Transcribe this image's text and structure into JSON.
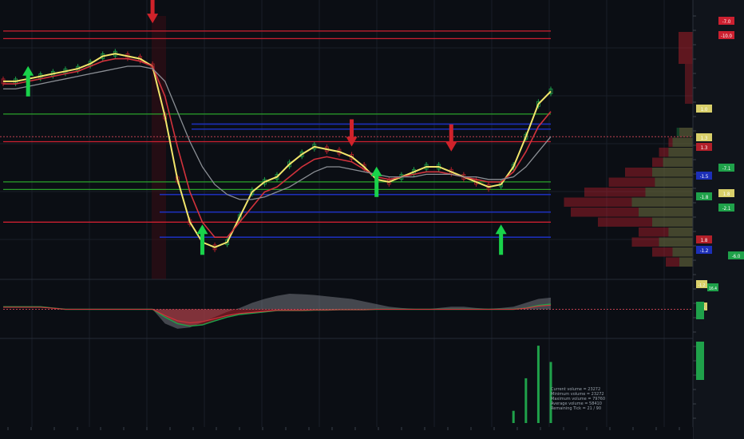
{
  "colors": {
    "background": "#0b0e14",
    "bull": "#1fa14a",
    "bear": "#b3202a",
    "fast_ma": "#f2e66b",
    "slow_ma": "#d2323c",
    "mid_ma": "#8b8f95",
    "support_line": "#2aa02a",
    "resistance_line": "#cc2030",
    "blue_level": "#1c2fb8",
    "buy_arrow": "#19d24a",
    "sell_arrow": "#d0222a"
  },
  "chart_data": [
    {
      "type": "line",
      "panel": "price",
      "series": [
        {
          "values": [
            0.74,
            0.74,
            0.75,
            0.76,
            0.77,
            0.78,
            0.79,
            0.81,
            0.84,
            0.85,
            0.84,
            0.83,
            0.8,
            0.6,
            0.35,
            0.18,
            0.1,
            0.08,
            0.1,
            0.2,
            0.3,
            0.34,
            0.36,
            0.41,
            0.45,
            0.48,
            0.47,
            0.46,
            0.44,
            0.4,
            0.35,
            0.34,
            0.36,
            0.38,
            0.4,
            0.4,
            0.38,
            0.36,
            0.34,
            0.32,
            0.33,
            0.4,
            0.52,
            0.65,
            0.7
          ]
        },
        {
          "values": [
            0.73,
            0.73,
            0.74,
            0.75,
            0.76,
            0.77,
            0.78,
            0.8,
            0.82,
            0.83,
            0.83,
            0.82,
            0.8,
            0.68,
            0.48,
            0.3,
            0.18,
            0.12,
            0.12,
            0.18,
            0.24,
            0.3,
            0.32,
            0.36,
            0.4,
            0.43,
            0.44,
            0.43,
            0.42,
            0.39,
            0.36,
            0.35,
            0.36,
            0.37,
            0.38,
            0.38,
            0.37,
            0.36,
            0.35,
            0.34,
            0.34,
            0.38,
            0.46,
            0.56,
            0.62
          ]
        },
        {
          "values": [
            0.71,
            0.71,
            0.72,
            0.73,
            0.74,
            0.75,
            0.76,
            0.77,
            0.78,
            0.79,
            0.8,
            0.8,
            0.79,
            0.74,
            0.62,
            0.5,
            0.4,
            0.33,
            0.29,
            0.27,
            0.27,
            0.28,
            0.3,
            0.32,
            0.35,
            0.38,
            0.4,
            0.4,
            0.39,
            0.38,
            0.37,
            0.36,
            0.36,
            0.36,
            0.37,
            0.37,
            0.37,
            0.36,
            0.36,
            0.35,
            0.35,
            0.36,
            0.4,
            0.46,
            0.52
          ]
        }
      ],
      "volume_profile": {
        "bull": [
          0.12,
          0.15,
          0.18,
          0.22,
          0.3,
          0.28,
          0.35,
          0.45,
          0.4,
          0.3,
          0.18,
          0.25,
          0.15,
          0.1
        ],
        "bear": [
          0.1,
          0.18,
          0.25,
          0.3,
          0.5,
          0.62,
          0.8,
          0.95,
          0.9,
          0.7,
          0.4,
          0.45,
          0.3,
          0.2
        ]
      },
      "horizontal_levels": {
        "resistance": [
          0.94,
          0.91,
          0.5,
          0.18
        ],
        "support": [
          0.61,
          0.34,
          0.31
        ],
        "blue": [
          0.57,
          0.55,
          0.29,
          0.22,
          0.12
        ],
        "dotted": [
          0.52
        ]
      },
      "signals": {
        "buy": [
          {
            "x": 2,
            "y": 0.68
          },
          {
            "x": 16,
            "y": 0.05
          },
          {
            "x": 30,
            "y": 0.28
          },
          {
            "x": 40,
            "y": 0.05
          }
        ],
        "sell": [
          {
            "x": 12,
            "y": 0.99
          },
          {
            "x": 28,
            "y": 0.5
          },
          {
            "x": 36,
            "y": 0.48
          }
        ]
      }
    },
    {
      "type": "area",
      "panel": "oscillator",
      "series": [
        {
          "values": [
            0,
            0,
            0,
            0,
            0,
            0,
            0,
            0,
            0,
            0,
            0,
            0,
            0,
            -0.55,
            -0.75,
            -0.7,
            -0.5,
            -0.3,
            -0.1,
            0.05,
            0.25,
            0.4,
            0.52,
            0.6,
            0.58,
            0.55,
            0.5,
            0.45,
            0.4,
            0.3,
            0.2,
            0.1,
            0.05,
            0.02,
            0.0,
            0.05,
            0.1,
            0.1,
            0.05,
            0.02,
            0.05,
            0.1,
            0.25,
            0.4,
            0.45
          ]
        },
        {
          "values": [
            0.1,
            0.1,
            0.1,
            0.1,
            0.05,
            0,
            0,
            0,
            0,
            0,
            0,
            0,
            0,
            -0.3,
            -0.55,
            -0.65,
            -0.6,
            -0.45,
            -0.3,
            -0.2,
            -0.15,
            -0.1,
            -0.05,
            -0.05,
            -0.05,
            -0.03,
            -0.03,
            -0.02,
            -0.02,
            -0.02,
            0,
            0,
            0,
            0,
            0,
            0,
            0,
            0,
            0,
            0,
            0,
            0,
            0.05,
            0.15,
            0.2
          ]
        }
      ]
    },
    {
      "type": "bar",
      "panel": "volume",
      "values": [
        0,
        0,
        0,
        0,
        0,
        0,
        0,
        0,
        0,
        0,
        0,
        0,
        0,
        0,
        0,
        0,
        0,
        0,
        0,
        0,
        0,
        0,
        0,
        0,
        0,
        0,
        0,
        0,
        0,
        0,
        0,
        0,
        0,
        0,
        0,
        0,
        0,
        0,
        0,
        0,
        0,
        0.15,
        0.55,
        0.95,
        0.75
      ]
    }
  ],
  "price_axis": {
    "tags": [
      {
        "text": "-7.0",
        "color": "#cc2030"
      },
      {
        "text": "-10.0",
        "color": "#cc2030"
      },
      {
        "text": "1.0",
        "color": "#d8cf6a"
      },
      {
        "text": "1.3",
        "color": "#d8cf6a"
      },
      {
        "text": "1.3",
        "color": "#b3202a"
      },
      {
        "text": "-7.1",
        "color": "#1fa14a"
      },
      {
        "text": "-1.5",
        "color": "#1c2fb8"
      },
      {
        "text": "1.8",
        "color": "#d8cf6a"
      },
      {
        "text": "-1.8",
        "color": "#1fa14a"
      },
      {
        "text": "-2.1",
        "color": "#1fa14a"
      },
      {
        "text": "1.8",
        "color": "#b3202a"
      },
      {
        "text": "-1.2",
        "color": "#1c2fb8"
      },
      {
        "text": "-6.0",
        "color": "#1fa14a"
      }
    ],
    "osc_tags": [
      {
        "text": "-1.2",
        "color": "#d8cf6a"
      },
      {
        "text": "16.4",
        "color": "#1fa14a"
      },
      {
        "text": "-2.1",
        "color": "#d8cf6a"
      }
    ]
  },
  "volume_stats": {
    "current": "Current volume = 23272",
    "minimum": "Minimum volume = 23272",
    "maximum": "Maximum volume = 79760",
    "average": "Average volume = 58410",
    "remaining": "Remaining Tick = 21 / 90"
  }
}
